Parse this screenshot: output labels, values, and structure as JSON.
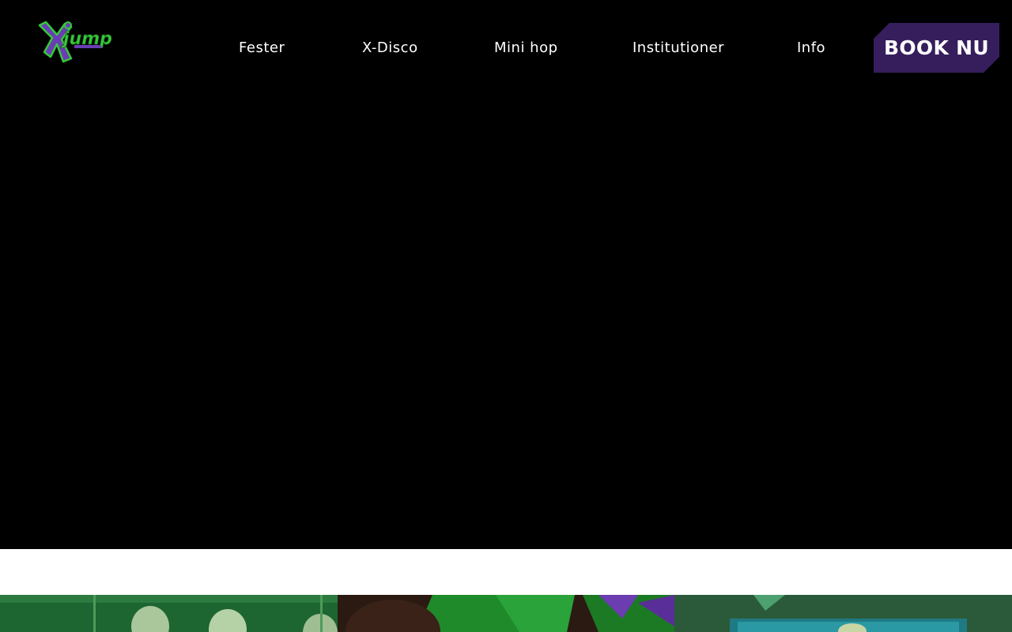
{
  "logo": {
    "text": "Xjump",
    "icon": "xjump-logo",
    "colors": {
      "green": "#35c93a",
      "purple": "#6a3db5"
    }
  },
  "nav": {
    "items": [
      {
        "label": "Fester"
      },
      {
        "label": "X-Disco"
      },
      {
        "label": "Mini hop"
      },
      {
        "label": "Institutioner"
      },
      {
        "label": "Info"
      }
    ]
  },
  "cta": {
    "label": "BOOK NU",
    "color": "#361e5c"
  },
  "hero": {
    "background": "#000000"
  },
  "tiles": [
    {
      "name": "photo-tile-1"
    },
    {
      "name": "photo-tile-2"
    },
    {
      "name": "photo-tile-3"
    }
  ]
}
